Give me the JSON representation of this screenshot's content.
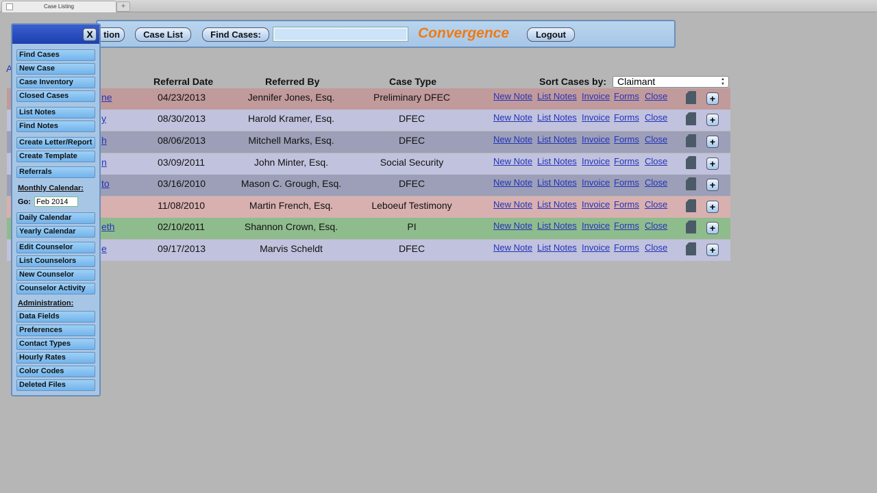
{
  "browser": {
    "tab_title": "Case Listing",
    "new_tab_label": "+"
  },
  "toolbar": {
    "partial_button": "tion",
    "case_list": "Case List",
    "find_cases": "Find Cases:",
    "search_value": "",
    "brand": "Convergence",
    "logout": "Logout"
  },
  "menu": {
    "close_label": "X",
    "items": {
      "find_cases": "Find Cases",
      "new_case": "New Case",
      "case_inventory": "Case Inventory",
      "closed_cases": "Closed Cases",
      "list_notes": "List Notes",
      "find_notes": "Find Notes",
      "create_letter": "Create Letter/Report",
      "create_template": "Create Template",
      "referrals": "Referrals",
      "daily_calendar": "Daily Calendar",
      "yearly_calendar": "Yearly Calendar",
      "edit_counselor": "Edit Counselor",
      "list_counselors": "List Counselors",
      "new_counselor": "New Counselor",
      "counselor_activity": "Counselor Activity",
      "data_fields": "Data Fields",
      "preferences": "Preferences",
      "contact_types": "Contact Types",
      "hourly_rates": "Hourly Rates",
      "color_codes": "Color Codes",
      "deleted_files": "Deleted Files"
    },
    "monthly_calendar_label": "Monthly Calendar:",
    "go_label": "Go:",
    "go_value": "Feb 2014",
    "administration_label": "Administration:"
  },
  "stray_text": "A",
  "table": {
    "headers": {
      "referral_date": "Referral Date",
      "referred_by": "Referred By",
      "case_type": "Case Type",
      "sort_label": "Sort Cases by:"
    },
    "sort_value": "Claimant",
    "actions": [
      "New Note",
      "List Notes",
      "Invoice",
      "Forms",
      "Close"
    ],
    "plus_label": "+",
    "rows": [
      {
        "name": "ne",
        "date": "04/23/2013",
        "referred_by": "Jennifer Jones, Esq.",
        "case_type": "Preliminary DFEC",
        "color": "#c19a9b"
      },
      {
        "name": "y",
        "date": "08/30/2013",
        "referred_by": "Harold Kramer, Esq.",
        "case_type": "DFEC",
        "color": "#c1c2dd"
      },
      {
        "name": "h",
        "date": "08/06/2013",
        "referred_by": "Mitchell Marks, Esq.",
        "case_type": "DFEC",
        "color": "#9c9fb7"
      },
      {
        "name": "n",
        "date": "03/09/2011",
        "referred_by": "John Minter, Esq.",
        "case_type": "Social Security",
        "color": "#c1c2dd"
      },
      {
        "name": "to",
        "date": "03/16/2010",
        "referred_by": "Mason C. Grough, Esq.",
        "case_type": "DFEC",
        "color": "#9c9fb7"
      },
      {
        "name": "",
        "date": "11/08/2010",
        "referred_by": "Martin French, Esq.",
        "case_type": "Leboeuf Testimony",
        "color": "#d8b0b0"
      },
      {
        "name": "eth",
        "date": "02/10/2011",
        "referred_by": "Shannon Crown, Esq.",
        "case_type": "PI",
        "color": "#8fbc8d"
      },
      {
        "name": "e",
        "date": "09/17/2013",
        "referred_by": "Marvis Scheldt",
        "case_type": "DFEC",
        "color": "#c1c2dd"
      }
    ]
  }
}
